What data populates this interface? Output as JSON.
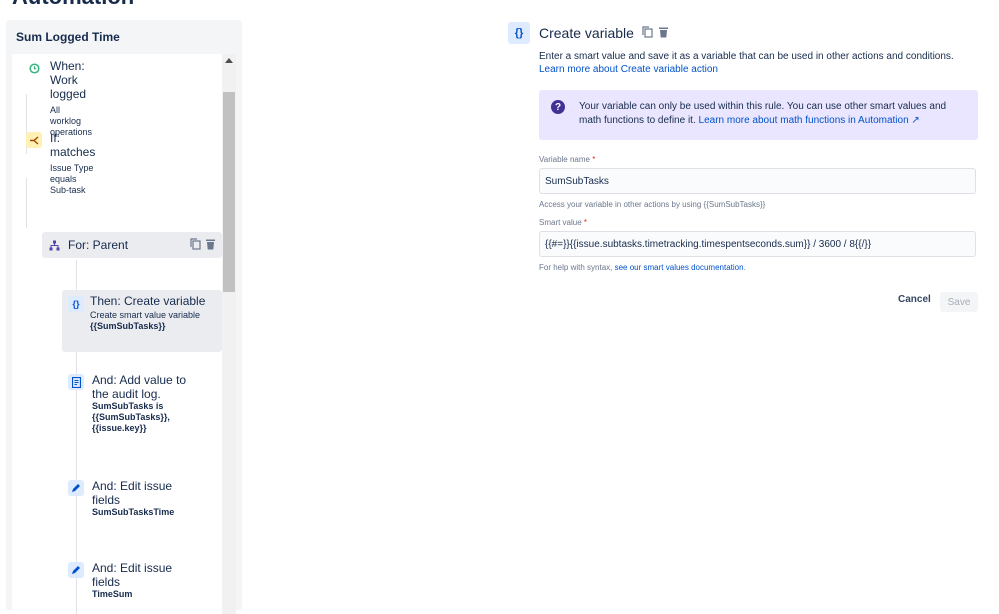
{
  "page": {
    "title": "Automation"
  },
  "rule": {
    "name": "Sum Logged Time",
    "components": [
      {
        "type": "trigger",
        "title": "When: Work logged",
        "description": "All worklog operations",
        "icon": "clock-icon"
      },
      {
        "type": "condition",
        "title": "If: matches",
        "description": "Issue Type equals Sub-task",
        "icon": "condition-icon"
      },
      {
        "type": "branch",
        "title": "For: Parent",
        "icon": "branch-icon"
      },
      {
        "type": "action",
        "title": "Then: Create variable",
        "description": "Create smart value variable",
        "description_bold": "{{SumSubTasks}}",
        "icon": "braces-icon",
        "selected": true
      },
      {
        "type": "action",
        "title": "And: Add value to the audit log.",
        "description_bold": "SumSubTasks is {{SumSubTasks}}, {{issue.key}}",
        "icon": "log-icon"
      },
      {
        "type": "action",
        "title": "And: Edit issue fields",
        "description_bold": "SumSubTasksTime",
        "icon": "pencil-icon"
      },
      {
        "type": "action",
        "title": "And: Edit issue fields",
        "description_bold": "TimeSum",
        "icon": "pencil-icon"
      }
    ]
  },
  "detail": {
    "icon_text": "{}",
    "title": "Create variable",
    "description": "Enter a smart value and save it as a variable that can be used in other actions and conditions.",
    "description_link": "Learn more about Create variable action",
    "info": {
      "text": "Your variable can only be used within this rule. You can use other smart values and math functions to define it.",
      "link": "Learn more about math functions in Automation ↗"
    },
    "variable_name": {
      "label": "Variable name",
      "required": "*",
      "value": "SumSubTasks",
      "help": "Access your variable in other actions by using {{SumSubTasks}}"
    },
    "smart_value": {
      "label": "Smart value",
      "required": "*",
      "value": "{{#=}}{{issue.subtasks.timetracking.timespentseconds.sum}} / 3600 / 8{{/}}",
      "help_prefix": "For help with syntax,",
      "help_link": "see our smart values documentation",
      "help_suffix": "."
    },
    "cancel_label": "Cancel",
    "save_label": "Save"
  },
  "colors": {
    "accent": "#0052CC",
    "info_bg": "#EAE6FF",
    "panel_bg": "#F4F5F7"
  }
}
